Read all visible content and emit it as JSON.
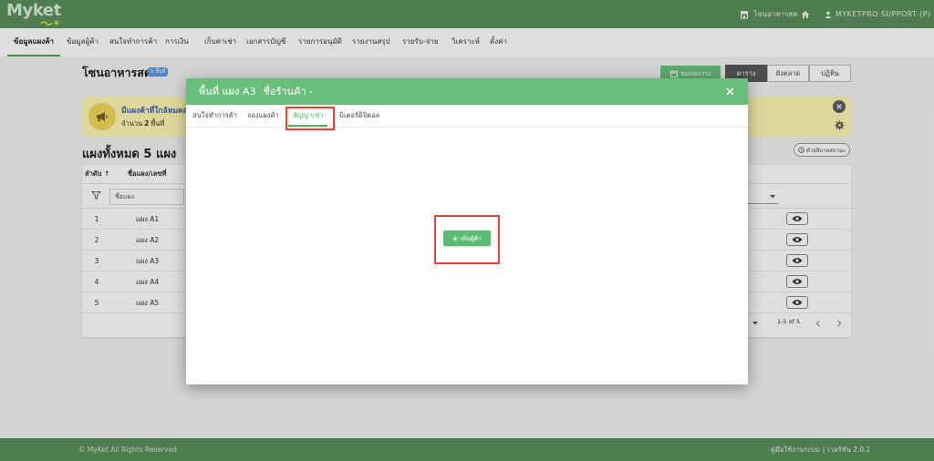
{
  "topbar": {
    "logo": "Myket",
    "store_name": "โซนอาหารสด",
    "user_name": "MYKETPRO SUPPORT (P)",
    "icons": [
      "store-icon",
      "home-icon",
      "user-icon"
    ]
  },
  "nav": {
    "items": [
      {
        "label": "ข้อมูลแผงค้า",
        "active": true
      },
      {
        "label": "ข้อมูลผู้ค้า",
        "active": false
      },
      {
        "label": "สนใจทำการค้า",
        "active": false
      },
      {
        "label": "การเงิน",
        "active": false
      },
      {
        "label": "เก็บค่าเช่า",
        "active": false
      },
      {
        "label": "เอกสารบัญชี",
        "active": false
      },
      {
        "label": "รายการอนุมัติ",
        "active": false
      },
      {
        "label": "รายงานสรุป",
        "active": false
      },
      {
        "label": "รายรับ-จ่าย",
        "active": false
      },
      {
        "label": "วิเคราะห์",
        "active": false
      },
      {
        "label": "ตั้งค่า",
        "active": false
      }
    ]
  },
  "page": {
    "title": "โซนอาหารสด",
    "badge": "5 พื้นที่",
    "book_button": {
      "label": "จองแผงว่าง",
      "icon": "calendar-icon"
    },
    "view_tabs": [
      {
        "label": "ตาราง",
        "active": true
      },
      {
        "label": "ผังตลาด",
        "active": false
      },
      {
        "label": "ปฏิทิน",
        "active": false
      }
    ]
  },
  "notice": {
    "icon": "megaphone-icon",
    "title": "มีแผงค้าที่ใกล้หมดส",
    "count_prefix": "จำนวน",
    "count": "2",
    "count_suffix": "พื้นที่"
  },
  "stalls": {
    "heading": "แผงทั้งหมด 5 แผง",
    "legend_button": "คำอธิบายสถานะ",
    "columns": {
      "index": "ลำดับ",
      "name": "ชื่อแผง/เลขที่"
    },
    "sort_indicator": "↑",
    "filter_placeholder": "ชื่อแผง",
    "rows": [
      {
        "index": "1",
        "name": "แผง A1"
      },
      {
        "index": "2",
        "name": "แผง A2"
      },
      {
        "index": "3",
        "name": "แผง A3"
      },
      {
        "index": "4",
        "name": "แผง A4"
      },
      {
        "index": "5",
        "name": "แผง A5"
      }
    ],
    "pagination": {
      "range": "1-5 of 5"
    }
  },
  "modal": {
    "title": "พื้นที่ แผง A3",
    "shop": "ชื่อร้านค้า -",
    "tabs": [
      {
        "label": "สนใจทำการค้า",
        "active": false
      },
      {
        "label": "จองแผงค้า",
        "active": false
      },
      {
        "label": "สัญญาเช่า",
        "active": true
      },
      {
        "label": "มิเตอร์ดิจิตอล",
        "active": false
      }
    ],
    "add_button": "เพิ่มผู้ค้า"
  },
  "footer": {
    "copyright": "© MyKet All Rights Reserved",
    "manual_link": "คู่มือใช้งานระบบ",
    "separator": "|",
    "version": "เวอร์ชัน 2.0.1"
  },
  "colors": {
    "brand_green": "#5a905c",
    "modal_header": "#6abe7c",
    "accent": "#4caf63",
    "button_green": "#5cbb6f",
    "highlight_red": "#e0443a",
    "notice_bg": "#fff7b3",
    "badge_blue": "#5b9be0",
    "active_view": "#595959"
  }
}
